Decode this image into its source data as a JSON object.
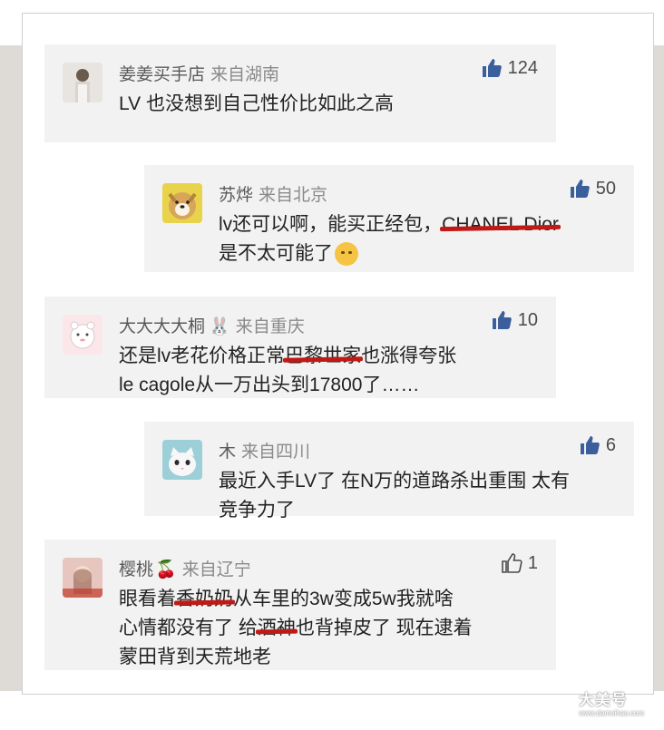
{
  "comments": [
    {
      "user": "姜姜买手店",
      "region": "来自湖南",
      "likes": "124",
      "avatar": "person-photo-avatar",
      "lines": [
        "LV 也没想到自己性价比如此之高"
      ]
    },
    {
      "user": "苏烨",
      "region": "来自北京",
      "likes": "50",
      "avatar": "dog-photo-avatar",
      "line1_pre": "lv还可以啊，能买正经包，",
      "line1_strike": "CHANEL Dior",
      "line2": "是不太可能了"
    },
    {
      "user": "大大大大桐",
      "region": "来自重庆",
      "likes": "10",
      "avatar": "cartoon-bear-avatar",
      "line1_pre": "还是lv老花价格正常",
      "line1_strike": "巴黎世家",
      "line1_post": "也涨得夸张",
      "line2": "le cagole从一万出头到17800了……"
    },
    {
      "user": "木",
      "region": "来自四川",
      "likes": "6",
      "avatar": "cat-photo-avatar",
      "lines": [
        "最近入手LV了 在N万的道路杀出重围 太有",
        "竞争力了"
      ]
    },
    {
      "user": "樱桃",
      "region": "来自辽宁",
      "likes": "1",
      "avatar": "girl-photo-avatar",
      "line1_pre": "眼看着",
      "line1_strike": "香奶奶",
      "line1_post": "从车里的3w变成5w我就啥",
      "line2_pre": "心情都没有了 给",
      "line2_strike": "酒神",
      "line2_post": "也背掉皮了 现在逮着",
      "line3": "蒙田背到天荒地老"
    }
  ],
  "watermark": {
    "main": "大美号",
    "sub": "www.dameihao.com"
  },
  "colors": {
    "strike": "#c01a16",
    "like_icon": "#3b5e9c",
    "card_bg": "#f2f2f2"
  }
}
